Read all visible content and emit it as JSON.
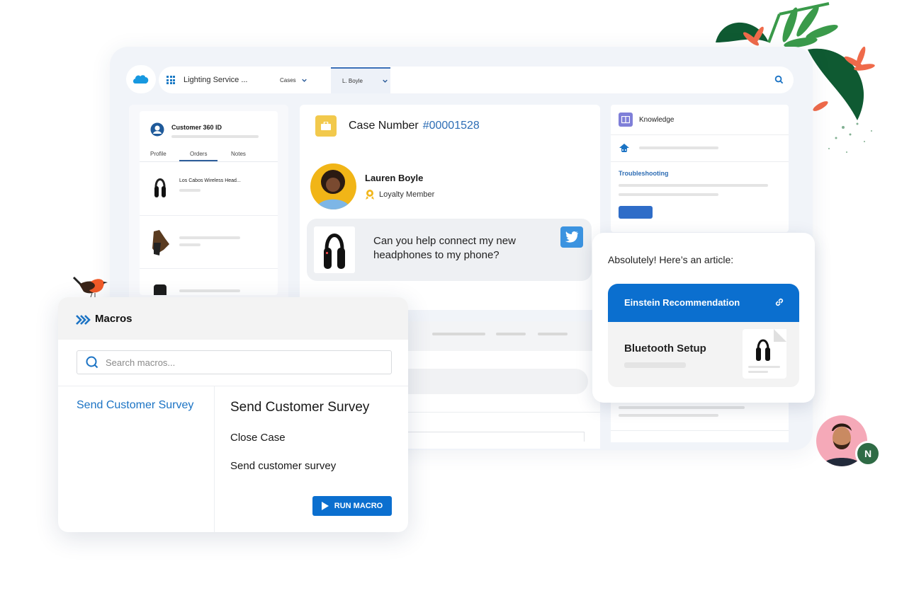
{
  "topbar": {
    "logo": "salesforce-cloud-icon",
    "app_launcher_icon": "app-launcher-grid-icon",
    "app_name": "Lighting Service ...",
    "tabs": [
      {
        "label": "Cases",
        "active": false
      },
      {
        "label": "L. Boyle",
        "active": true
      }
    ],
    "search_icon": "search-icon"
  },
  "customer_panel": {
    "title": "Customer 360 ID",
    "tabs": [
      {
        "label": "Profile",
        "active": false
      },
      {
        "label": "Orders",
        "active": true
      },
      {
        "label": "Notes",
        "active": false
      }
    ],
    "orders": [
      {
        "name": "Los Cabos Wireless Head...",
        "image": "headphones"
      },
      {
        "name": "",
        "image": "glove"
      },
      {
        "name": "",
        "image": "backpack"
      }
    ]
  },
  "case": {
    "label": "Case Number",
    "number": "#00001528",
    "customer_name": "Lauren Boyle",
    "customer_badge": "Loyalty Member",
    "message": "Can you help connect my new headphones to my phone?",
    "channel": "twitter"
  },
  "knowledge": {
    "title": "Knowledge",
    "section_link": "Troubleshooting"
  },
  "article_reply": {
    "intro": "Absolutely! Here’s an article:",
    "recommendation_label": "Einstein Recommendation",
    "article_title": "Bluetooth Setup"
  },
  "macros": {
    "title": "Macros",
    "search_placeholder": "Search macros...",
    "list": [
      "Send Customer Survey"
    ],
    "detail_title": "Send Customer Survey",
    "steps": [
      "Close Case",
      "Send customer survey"
    ],
    "run_button": "RUN MACRO"
  },
  "agent": {
    "badge_letter": "N"
  },
  "colors": {
    "brand_blue": "#0b6fcf",
    "link_blue": "#1b73c4",
    "case_icon_yellow": "#f2c94c",
    "knowledge_purple": "#7f7fd8",
    "twitter_blue": "#3b93e0",
    "agent_badge_green": "#2f6b45"
  }
}
